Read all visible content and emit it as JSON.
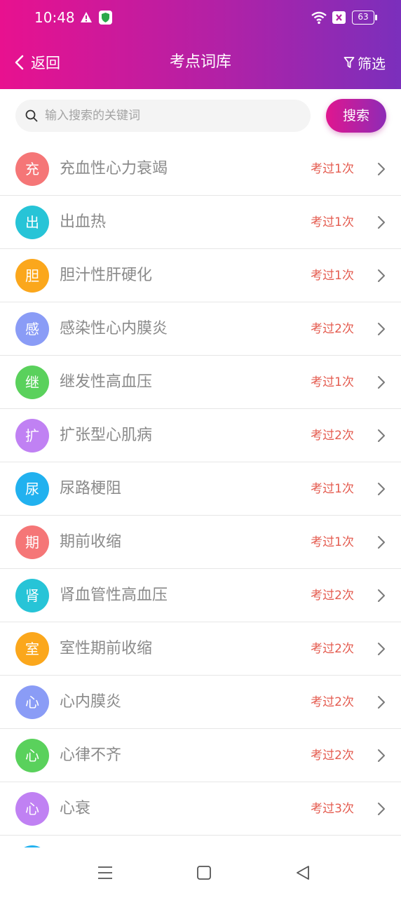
{
  "status_bar": {
    "time": "10:48",
    "battery": "63"
  },
  "header": {
    "back_label": "返回",
    "title": "考点词库",
    "filter_label": "筛选"
  },
  "search": {
    "placeholder": "输入搜索的关键词",
    "button_label": "搜索"
  },
  "items": [
    {
      "initial": "充",
      "name": "充血性心力衰竭",
      "count": "考过1次",
      "color": "#f57677"
    },
    {
      "initial": "出",
      "name": "出血热",
      "count": "考过1次",
      "color": "#27c4d7"
    },
    {
      "initial": "胆",
      "name": "胆汁性肝硬化",
      "count": "考过1次",
      "color": "#fba71c"
    },
    {
      "initial": "感",
      "name": "感染性心内膜炎",
      "count": "考过2次",
      "color": "#8a9cf6"
    },
    {
      "initial": "继",
      "name": "继发性高血压",
      "count": "考过1次",
      "color": "#5ad15c"
    },
    {
      "initial": "扩",
      "name": "扩张型心肌病",
      "count": "考过2次",
      "color": "#c081f3"
    },
    {
      "initial": "尿",
      "name": "尿路梗阻",
      "count": "考过1次",
      "color": "#21b1ef"
    },
    {
      "initial": "期",
      "name": "期前收缩",
      "count": "考过1次",
      "color": "#f57677"
    },
    {
      "initial": "肾",
      "name": "肾血管性高血压",
      "count": "考过2次",
      "color": "#27c4d7"
    },
    {
      "initial": "室",
      "name": "室性期前收缩",
      "count": "考过2次",
      "color": "#fba71c"
    },
    {
      "initial": "心",
      "name": "心内膜炎",
      "count": "考过2次",
      "color": "#8a9cf6"
    },
    {
      "initial": "心",
      "name": "心律不齐",
      "count": "考过2次",
      "color": "#5ad15c"
    },
    {
      "initial": "心",
      "name": "心衰",
      "count": "考过3次",
      "color": "#c081f3"
    },
    {
      "initial": "",
      "name": "",
      "count": "",
      "color": "#21b1ef"
    }
  ],
  "icons": {
    "status": [
      "warning-icon",
      "shield-icon",
      "wifi-icon",
      "close-box-icon",
      "battery-icon"
    ],
    "nav": [
      "chevron-left-icon",
      "filter-icon",
      "search-icon",
      "chevron-right-icon"
    ],
    "system_nav": [
      "menu-icon",
      "home-icon",
      "back-triangle-icon"
    ]
  }
}
